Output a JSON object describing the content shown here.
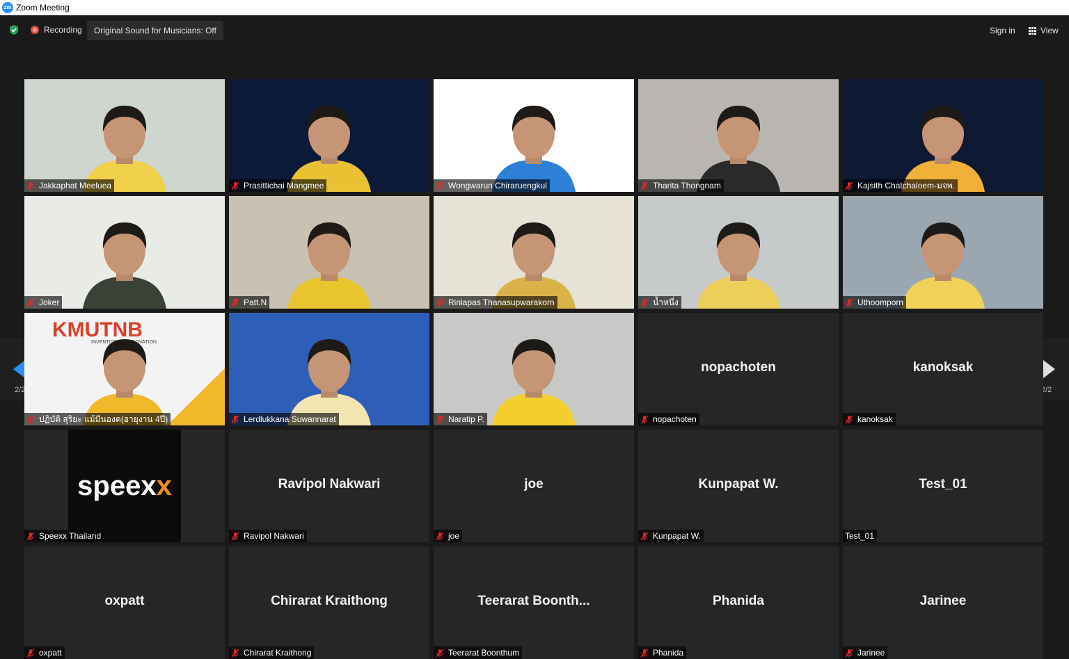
{
  "window": {
    "title": "Zoom Meeting",
    "app_icon": "zoom-logo-icon"
  },
  "topbar": {
    "recording_label": "Recording",
    "original_sound_label": "Original Sound for Musicians: Off",
    "sign_in_label": "Sign in",
    "view_label": "View"
  },
  "pagination": {
    "left_indicator": "2/2",
    "right_indicator": "2/2"
  },
  "colors": {
    "accent": "#2d8cff",
    "mic_muted": "#e02828",
    "tile_bg": "#262626",
    "background": "#1a1a1a"
  },
  "participants": [
    {
      "name": "Jakkaphat Meeluea",
      "video": true,
      "muted": true,
      "bg": "#cfd6cf",
      "fg": "#f1d04a"
    },
    {
      "name": "Prasittichai Mangmee",
      "video": true,
      "muted": true,
      "bg": "#0c1a3a",
      "fg": "#e8c233"
    },
    {
      "name": "Wongwarun Chiraruengkul",
      "video": true,
      "muted": true,
      "bg": "#ffffff",
      "fg": "#2e7fd6"
    },
    {
      "name": "Tharita Thongnam",
      "video": true,
      "muted": true,
      "bg": "#b9b6b2",
      "fg": "#2a2a2a"
    },
    {
      "name": "Kajsith Chatchaloem-มจพ.",
      "video": true,
      "muted": true,
      "bg": "#0e1a33",
      "fg": "#f0b13a"
    },
    {
      "name": "Joker",
      "video": true,
      "muted": true,
      "bg": "#e9ece6",
      "fg": "#3a4238"
    },
    {
      "name": "Patt.N",
      "video": true,
      "muted": true,
      "bg": "#c9c2b2",
      "fg": "#e8c52c"
    },
    {
      "name": "Rinlapas Thanasupwarakorn",
      "video": true,
      "muted": true,
      "bg": "#e6e2d6",
      "fg": "#d9b34a"
    },
    {
      "name": "น้ำหนึ่ง",
      "video": true,
      "muted": true,
      "bg": "#c7cacb",
      "fg": "#ebcf5a"
    },
    {
      "name": "Uthoomporn",
      "video": true,
      "muted": true,
      "bg": "#9aa7b1",
      "fg": "#f0d25a"
    },
    {
      "name": "ปฏิบัติ สุริยะ แม้มีนองค(อายุงาน 4ปี)",
      "video": true,
      "muted": true,
      "bg": "#f3f3f3",
      "fg": "#f0b92a",
      "logo_text": "KMUTNB",
      "logo_sub": "INVENTION TO INNOVATION"
    },
    {
      "name": "Lerdlukkana Suwannarat",
      "video": true,
      "muted": true,
      "bg": "#2e5fb8",
      "fg": "#f1e6b0"
    },
    {
      "name": "Naratip P.",
      "video": true,
      "muted": true,
      "bg": "#c8c8c6",
      "fg": "#f2cf2e"
    },
    {
      "name": "nopachoten",
      "video": false,
      "muted": true,
      "display": "nopachoten"
    },
    {
      "name": "kanoksak",
      "video": false,
      "muted": true,
      "display": "kanoksak"
    },
    {
      "name": "Speexx Thailand",
      "video": false,
      "muted": true,
      "logo": "speexx"
    },
    {
      "name": "Ravipol Nakwari",
      "video": false,
      "muted": true,
      "display": "Ravipol Nakwari"
    },
    {
      "name": "joe",
      "video": false,
      "muted": true,
      "display": "joe"
    },
    {
      "name": "Kunpapat W.",
      "video": false,
      "muted": true,
      "display": "Kunpapat W."
    },
    {
      "name": "Test_01",
      "video": false,
      "muted": false,
      "display": "Test_01"
    },
    {
      "name": "oxpatt",
      "video": false,
      "muted": true,
      "display": "oxpatt"
    },
    {
      "name": "Chirarat Kraithong",
      "video": false,
      "muted": true,
      "display": "Chirarat Kraithong"
    },
    {
      "name": "Teerarat Boonthum",
      "video": false,
      "muted": true,
      "display": "Teerarat  Boonth..."
    },
    {
      "name": "Phanida",
      "video": false,
      "muted": true,
      "display": "Phanida"
    },
    {
      "name": "Jarinee",
      "video": false,
      "muted": true,
      "display": "Jarinee"
    }
  ],
  "speexx_logo": {
    "main": "speex",
    "accent": "x"
  }
}
